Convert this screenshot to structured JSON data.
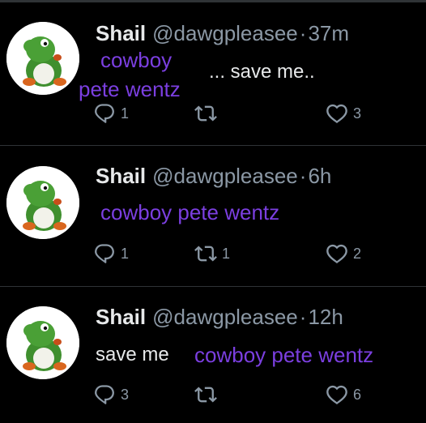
{
  "tweets": [
    {
      "name": "Shail",
      "handle": "@dawgpleasee",
      "separator": "·",
      "time": "37m",
      "text": "... save me..",
      "overlay_top": "cowboy",
      "overlay_bottom": "pete wentz",
      "replies": "1",
      "retweets": "",
      "likes": "3"
    },
    {
      "name": "Shail",
      "handle": "@dawgpleasee",
      "separator": "·",
      "time": "6h",
      "text": "",
      "overlay_top": "cowboy pete wentz",
      "replies": "1",
      "retweets": "1",
      "likes": "2"
    },
    {
      "name": "Shail",
      "handle": "@dawgpleasee",
      "separator": "·",
      "time": "12h",
      "text": "save me",
      "overlay_top": "cowboy pete wentz",
      "replies": "3",
      "retweets": "",
      "likes": "6"
    }
  ],
  "icons": {
    "reply": "reply-icon",
    "retweet": "retweet-icon",
    "like": "heart-icon",
    "avatar": "yoshi-plush-avatar"
  },
  "colors": {
    "background": "#000000",
    "text_primary": "#e7e9ea",
    "text_secondary": "#8b98a5",
    "overlay_text": "#7b3fe0",
    "divider": "#2f3336"
  }
}
